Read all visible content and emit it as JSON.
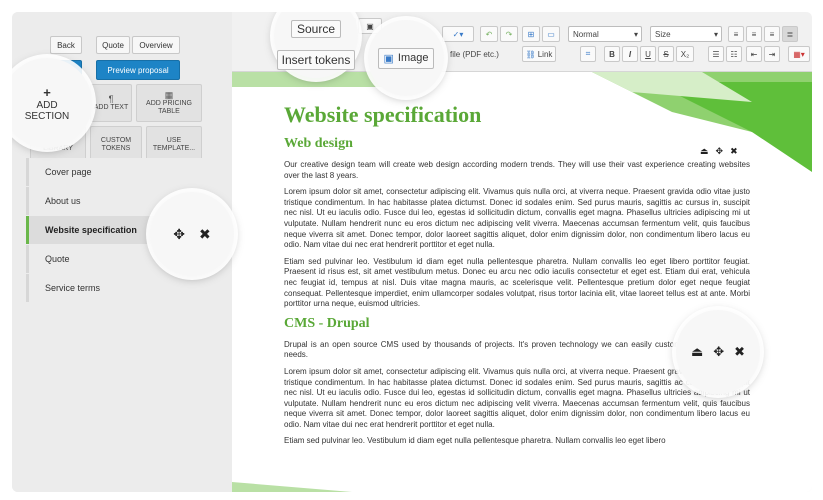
{
  "left_panel": {
    "back_label": "Back",
    "quote_label": "Quote",
    "overview_label": "Overview",
    "preview_label": "Preview proposal",
    "add_section": {
      "glyph": "+",
      "line1": "ADD",
      "line2": "SECTION"
    },
    "tiles": {
      "add_text": "ADD TEXT",
      "add_pricing_table": "ADD PRICING TABLE",
      "block_library": "BLOCK LIBRARY",
      "custom_tokens": "CUSTOM TOKENS",
      "use_template": "USE TEMPLATE..."
    },
    "sections": [
      {
        "label": "Cover page"
      },
      {
        "label": "About us"
      },
      {
        "label": "Website specification"
      },
      {
        "label": "Quote"
      },
      {
        "label": "Service terms"
      }
    ]
  },
  "toolbar": {
    "source_label": "Source",
    "insert_tokens_label": "Insert tokens",
    "image_label": "Image",
    "file_label": "file (PDF etc.)",
    "link_label": "Link",
    "format_select": "Normal",
    "size_select": "Size",
    "bold": "B",
    "italic": "I",
    "underline": "U",
    "strike": "S",
    "subscript": "X₂"
  },
  "document": {
    "title": "Website specification",
    "sections": [
      {
        "heading": "Web design",
        "paragraphs": [
          "Our creative design team will create web design according modern trends. They will use their vast experience creating websites over the last 8 years.",
          "Lorem ipsum dolor sit amet, consectetur adipiscing elit. Vivamus quis nulla orci, at viverra neque. Praesent gravida odio vitae justo tristique condimentum. In hac habitasse platea dictumst. Donec id sodales enim. Sed purus mauris, sagittis ac cursus in, suscipit nec nisl. Ut eu iaculis odio. Fusce dui leo, egestas id sollicitudin dictum, convallis eget magna. Phasellus ultricies adipiscing mi ut vulputate. Nullam hendrerit nunc eu eros dictum nec adipiscing velit viverra. Maecenas accumsan fermentum velit, quis faucibus neque viverra sit amet. Donec tempor, dolor laoreet sagittis aliquet, dolor enim dignissim dolor, non condimentum libero lacus eu odio. Nam vitae dui nec erat hendrerit porttitor et eget nulla.",
          "Etiam sed pulvinar leo. Vestibulum id diam eget nulla pellentesque pharetra. Nullam convallis leo eget libero porttitor feugiat. Praesent id risus est, sit amet vestibulum metus. Donec eu arcu nec odio iaculis consectetur et eget est. Etiam dui erat, vehicula nec feugiat id, tempus at nisl. Duis vitae magna mauris, ac scelerisque velit. Pellentesque pretium dolor eget neque feugiat consequat. Pellentesque imperdiet, enim ullamcorper sodales volutpat, risus tortor lacinia elit, vitae laoreet tellus est at ante. Morbi porttitor urna neque, euismod ultricies."
        ]
      },
      {
        "heading": "CMS - Drupal",
        "paragraphs": [
          "Drupal is an open source CMS used by thousands of projects. It's proven technology we can easily customize to your specific needs.",
          "Lorem ipsum dolor sit amet, consectetur adipiscing elit. Vivamus quis nulla orci, at viverra neque. Praesent gravida odio vitae justo tristique condimentum. In hac habitasse platea dictumst. Donec id sodales enim. Sed purus mauris, sagittis ac cursus in, suscipit nec nisl. Ut eu iaculis odio. Fusce dui leo, egestas id sollicitudin dictum, convallis eget magna. Phasellus ultricies adipiscing mi ut vulputate. Nullam hendrerit nunc eu eros dictum nec adipiscing velit viverra. Maecenas accumsan fermentum velit, quis faucibus neque viverra sit amet. Donec tempor, dolor laoreet sagittis aliquet, dolor enim dignissim dolor, non condimentum libero lacus eu odio. Nam vitae dui nec erat hendrerit porttitor et eget nulla.",
          "Etiam sed pulvinar leo. Vestibulum id diam eget nulla pellentesque pharetra. Nullam convallis leo eget libero"
        ]
      }
    ]
  },
  "colors": {
    "accent_green": "#5aa837",
    "button_blue": "#1d84c6"
  },
  "icons": [
    "plus-icon",
    "move-icon",
    "close-icon",
    "bookmark-icon",
    "image-icon",
    "bold-icon",
    "italic-icon"
  ]
}
